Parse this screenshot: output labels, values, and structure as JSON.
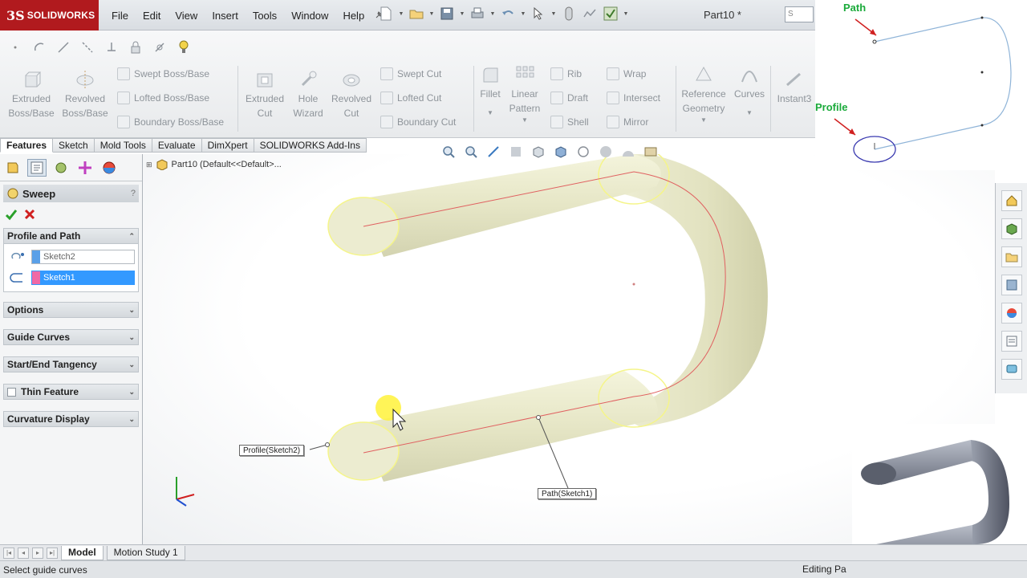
{
  "app": {
    "brand_mark": "3S",
    "brand_name": "SOLIDWORKS",
    "document_title": "Part10 *"
  },
  "menu": [
    "File",
    "Edit",
    "View",
    "Insert",
    "Tools",
    "Window",
    "Help"
  ],
  "search": {
    "placeholder": "S"
  },
  "command_manager": {
    "large": [
      {
        "label1": "Extruded",
        "label2": "Boss/Base"
      },
      {
        "label1": "Revolved",
        "label2": "Boss/Base"
      },
      {
        "label1": "Extruded",
        "label2": "Cut"
      },
      {
        "label1": "Hole",
        "label2": "Wizard"
      },
      {
        "label1": "Revolved",
        "label2": "Cut"
      },
      {
        "label1": "Fillet",
        "label2": ""
      },
      {
        "label1": "Linear",
        "label2": "Pattern"
      },
      {
        "label1": "Reference",
        "label2": "Geometry"
      },
      {
        "label1": "Curves",
        "label2": ""
      },
      {
        "label1": "Instant3",
        "label2": ""
      }
    ],
    "small": [
      "Swept Boss/Base",
      "Lofted Boss/Base",
      "Boundary Boss/Base",
      "Swept Cut",
      "Lofted Cut",
      "Boundary Cut",
      "Rib",
      "Draft",
      "Shell",
      "Wrap",
      "Intersect",
      "Mirror"
    ]
  },
  "tabs": [
    "Features",
    "Sketch",
    "Mold Tools",
    "Evaluate",
    "DimXpert",
    "SOLIDWORKS Add-Ins"
  ],
  "property_manager": {
    "title": "Sweep",
    "help": "?",
    "groups": {
      "profile_path": {
        "title": "Profile and Path",
        "profile": "Sketch2",
        "path": "Sketch1"
      },
      "options": "Options",
      "guide_curves": "Guide Curves",
      "tangency": "Start/End Tangency",
      "thin_feature": "Thin Feature",
      "curvature": "Curvature Display"
    }
  },
  "feature_tree": {
    "part": "Part10 (Default<<Default>..."
  },
  "callouts": {
    "profile": "Profile(Sketch2)",
    "path": "Path(Sketch1)"
  },
  "bottom_tabs": [
    "Model",
    "Motion Study 1"
  ],
  "status": {
    "left": "Select guide curves",
    "right": "Editing Pa"
  },
  "insets": {
    "path_label": "Path",
    "profile_label": "Profile"
  },
  "colors": {
    "brand": "#b11a1e",
    "selection": "#3399ff",
    "model": "#e9e9c9",
    "edge_highlight": "#ffff66",
    "path_line": "#e05050",
    "inset_label": "#1aaa3a"
  }
}
